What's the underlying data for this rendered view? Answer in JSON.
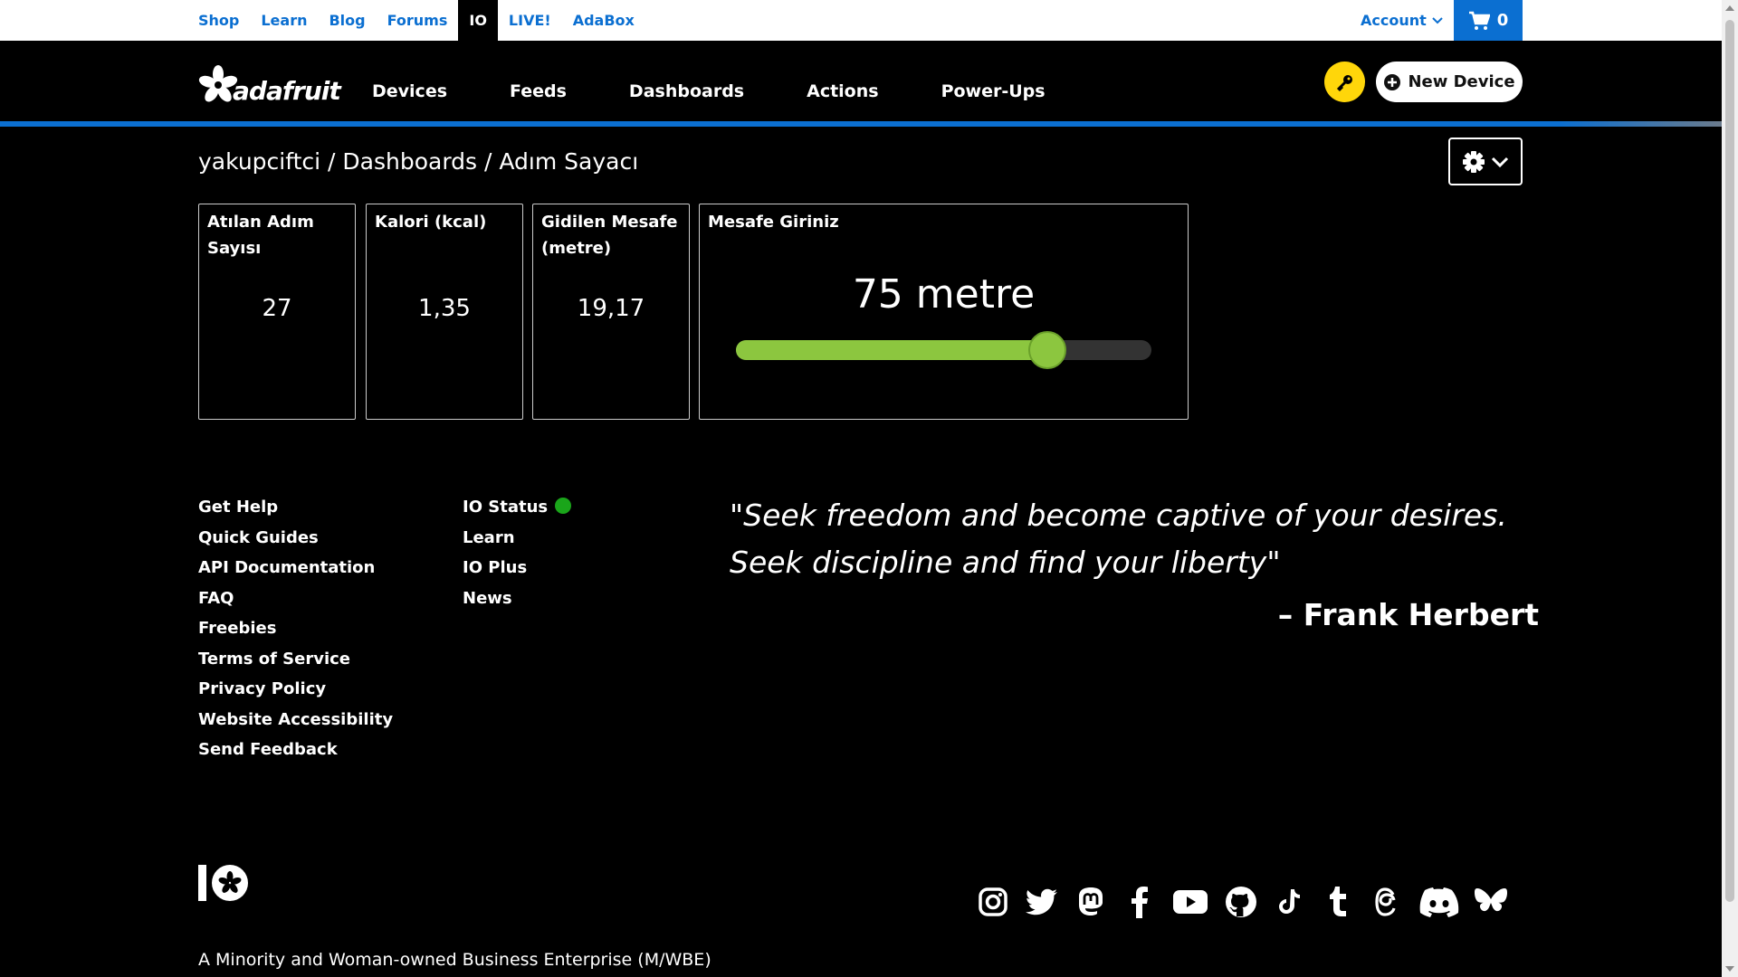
{
  "topnav": {
    "items": [
      "Shop",
      "Learn",
      "Blog",
      "Forums",
      "IO",
      "LIVE!",
      "AdaBox"
    ],
    "account": "Account",
    "cart_count": "0"
  },
  "header": {
    "logo_text": "adafruit",
    "nav": [
      "Devices",
      "Feeds",
      "Dashboards",
      "Actions",
      "Power-Ups"
    ],
    "new_device": "New Device"
  },
  "breadcrumb": "yakupciftci / Dashboards / Adım Sayacı",
  "blocks": [
    {
      "title": "Atılan Adım Sayısı",
      "value": "27"
    },
    {
      "title": "Kalori (kcal)",
      "value": "1,35"
    },
    {
      "title": "Gidilen Mesafe (metre)",
      "value": "19,17"
    }
  ],
  "slider": {
    "title": "Mesafe Giriniz",
    "label": "75 metre",
    "value": 75,
    "fraction": 0.75
  },
  "footer": {
    "col1": [
      "Get Help",
      "Quick Guides",
      "API Documentation",
      "FAQ",
      "Freebies",
      "Terms of Service",
      "Privacy Policy",
      "Website Accessibility",
      "Send Feedback"
    ],
    "col2": [
      "IO Status",
      "Learn",
      "IO Plus",
      "News"
    ],
    "quote": "\"Seek freedom and become captive of your desires. Seek discipline and find your liberty\"",
    "author": "– Frank Herbert",
    "mwbe": "A Minority and Woman-owned Business Enterprise (M/WBE)"
  },
  "social_icons": [
    "instagram-icon",
    "twitter-icon",
    "mastodon-icon",
    "facebook-icon",
    "youtube-icon",
    "github-icon",
    "tiktok-icon",
    "tumblr-icon",
    "threads-icon",
    "discord-icon",
    "bluesky-icon"
  ],
  "colors": {
    "accent_blue": "#0b6fd1",
    "slider_green": "#8cc63f",
    "status_green": "#1aa51a",
    "key_yellow": "#ffd60a"
  }
}
